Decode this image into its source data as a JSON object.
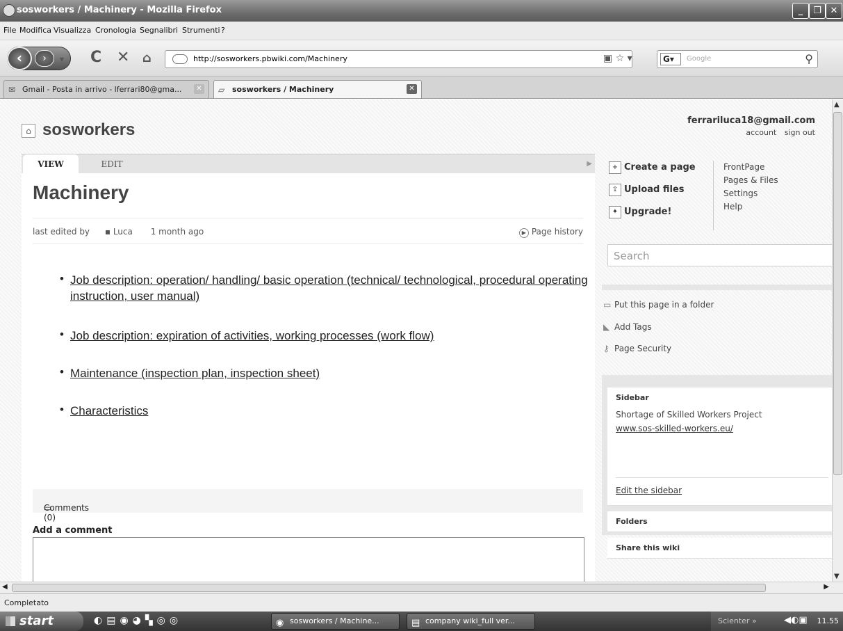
{
  "window": {
    "title": "sosworkers / Machinery - Mozilla Firefox",
    "controls": [
      "_",
      "❐",
      "✕"
    ]
  },
  "menu": [
    "File",
    "Modifica",
    "Visualizza",
    "Cronologia",
    "Segnalibri",
    "Strumenti",
    "?"
  ],
  "nav": {
    "url": "http://sosworkers.pbwiki.com/Machinery",
    "search_placeholder": "Google",
    "search_engine": "G"
  },
  "browser_tabs": [
    {
      "label": "Gmail - Posta in arrivo - lferrari80@gma...",
      "icon": "gmail-icon"
    },
    {
      "label": "sosworkers / Machinery",
      "icon": "page-icon"
    }
  ],
  "site": {
    "name": "sosworkers",
    "user_email": "ferrariluca18@gmail.com",
    "account_link": "account",
    "signout_link": "sign out"
  },
  "page": {
    "tabs": {
      "view": "VIEW",
      "edit": "EDIT"
    },
    "title": "Machinery",
    "last_edited_prefix": "last edited by",
    "author": "Luca",
    "time_ago": "1 month ago",
    "history": "Page history",
    "bullets": [
      "Job description: operation/ handling/ basic operation (technical/ technological, procedural operating instruction, user manual)",
      "Job description: expiration of activities, working processes (work flow)",
      "Maintenance (inspection plan, inspection sheet)",
      "Characteristics"
    ],
    "comments": "Comments (0)",
    "add_comment": "Add a comment"
  },
  "sidebar": {
    "actions": {
      "create": "Create a page",
      "upload": "Upload files",
      "upgrade": "Upgrade!"
    },
    "quick_links": [
      "FrontPage",
      "Pages & Files",
      "Settings",
      "Help"
    ],
    "search_placeholder": "Search",
    "page_options": [
      "Put this page in a folder",
      "Add Tags",
      "Page Security"
    ],
    "sidebar_box": {
      "header": "Sidebar",
      "text": "Shortage of Skilled Workers Project",
      "link": "www.sos-skilled-workers.eu/",
      "edit": "Edit the sidebar"
    },
    "folders_header": "Folders",
    "share_header": "Share this wiki"
  },
  "status": "Completato",
  "taskbar": {
    "start": "start",
    "tasks": [
      "sosworkers / Machine...",
      "company wiki_full ver..."
    ],
    "tray_label": "Scienter",
    "tray_chevron": "»",
    "time": "11.55"
  }
}
